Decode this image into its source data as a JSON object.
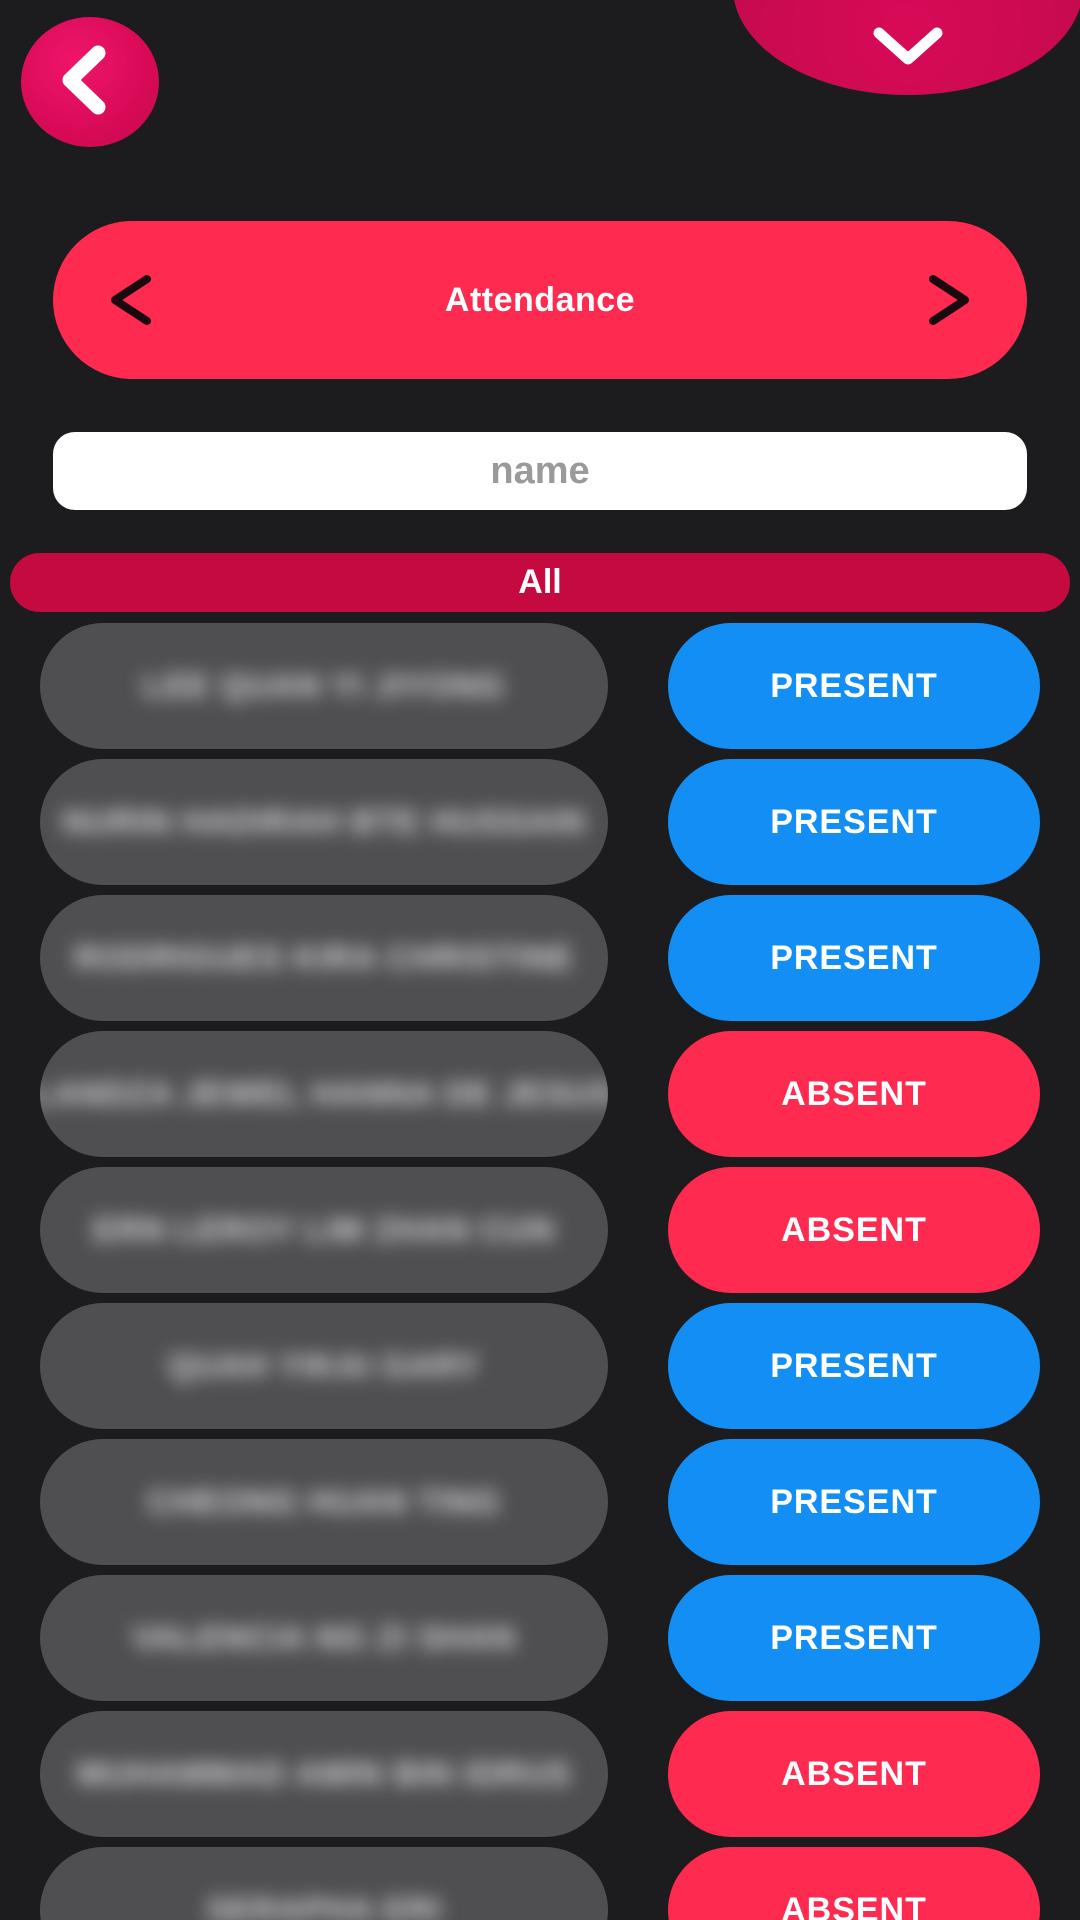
{
  "header": {
    "title": "Attendance"
  },
  "search": {
    "placeholder": "name",
    "value": ""
  },
  "filter": {
    "label": "All"
  },
  "colors": {
    "background": "#1c1c1e",
    "accent": "#ff2a50",
    "filter": "#c50a3f",
    "present": "#128ef5",
    "absent": "#ff2a50",
    "name_pill": "#4f4f52"
  },
  "icons": {
    "back": "back-chevron-icon",
    "dropdown": "chevron-down-icon",
    "prev": "chevron-left-icon",
    "next": "chevron-right-icon"
  },
  "students": [
    {
      "name": "LEE QUAN YI JIYONG",
      "status": "PRESENT"
    },
    {
      "name": "NURIN HADIRAH BTE HUSSAIN",
      "status": "PRESENT"
    },
    {
      "name": "RODRIGUES KIRA CHRISTINE",
      "status": "PRESENT"
    },
    {
      "name": "LANDZA JEWEL HANNA DE JESUS",
      "status": "ABSENT"
    },
    {
      "name": "ERN LEROY LIM ZHAN CUN",
      "status": "ABSENT"
    },
    {
      "name": "QUAH YIKAI GARY",
      "status": "PRESENT"
    },
    {
      "name": "CHEONG HUAN TING",
      "status": "PRESENT"
    },
    {
      "name": "VALENCIA NG ZI SHAN",
      "status": "PRESENT"
    },
    {
      "name": "MUHAMMAD AMIN BIN IDRUS",
      "status": "ABSENT"
    },
    {
      "name": "SERAPHA ERI",
      "status": "ABSENT"
    }
  ]
}
